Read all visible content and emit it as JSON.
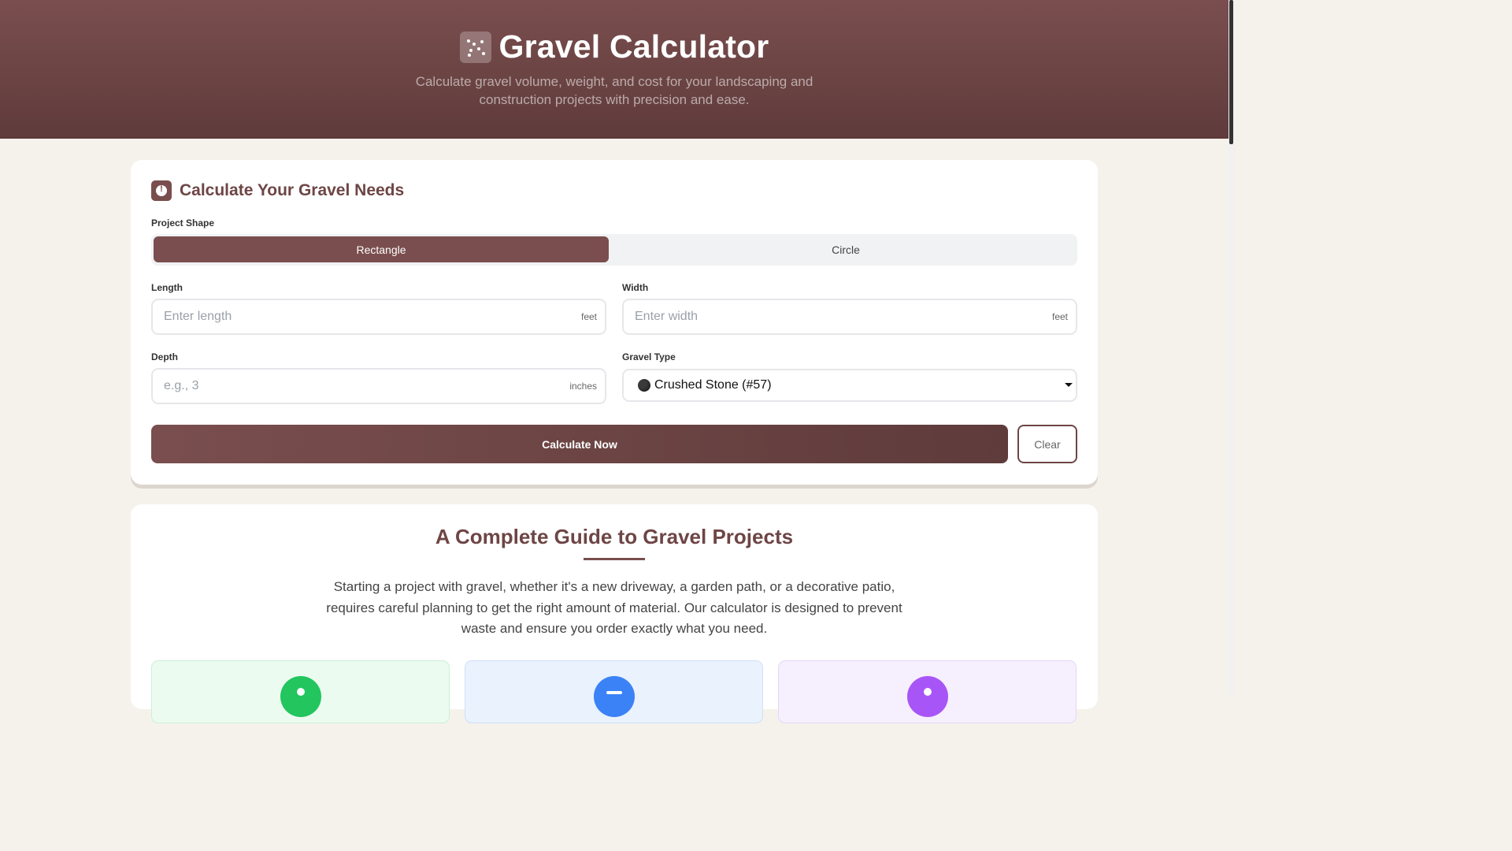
{
  "header": {
    "title": "Gravel Calculator",
    "subtitle": "Calculate gravel volume, weight, and cost for your landscaping and construction projects with precision and ease."
  },
  "calculator": {
    "title": "Calculate Your Gravel Needs",
    "shape_label": "Project Shape",
    "shapes": [
      "Rectangle",
      "Circle"
    ],
    "selected_shape": "Rectangle",
    "length": {
      "label": "Length",
      "placeholder": "Enter length",
      "unit": "feet",
      "value": ""
    },
    "width": {
      "label": "Width",
      "placeholder": "Enter width",
      "unit": "feet",
      "value": ""
    },
    "depth": {
      "label": "Depth",
      "placeholder": "e.g., 3",
      "unit": "inches",
      "value": ""
    },
    "gravel_type": {
      "label": "Gravel Type",
      "selected": "Crushed Stone (#57)"
    },
    "calculate_label": "Calculate Now",
    "clear_label": "Clear"
  },
  "guide": {
    "title": "A Complete Guide to Gravel Projects",
    "intro": "Starting a project with gravel, whether it's a new driveway, a garden path, or a decorative patio, requires careful planning to get the right amount of material. Our calculator is designed to prevent waste and ensure you order exactly what you need."
  },
  "colors": {
    "primary": "#7a4e4e",
    "primary_dark": "#5f3b3b",
    "background": "#f5f2ec",
    "feature_green": "#22c55e",
    "feature_blue": "#3b82f6",
    "feature_purple": "#a855f7"
  }
}
